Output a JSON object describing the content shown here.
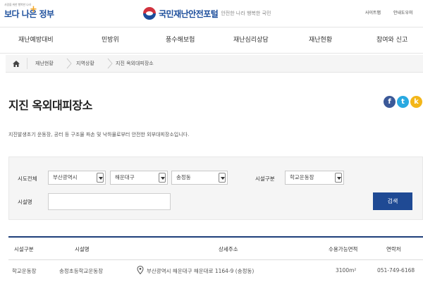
{
  "header": {
    "slogan_small": "사람을 위한 행복한 나라",
    "slogan_big": "보다 나은 정부",
    "title": "국민재난안전포털",
    "subtitle": "안전한 나라 행복한 국민",
    "util_sitemap": "사이트맵",
    "util_help": "안내도우미"
  },
  "gnb": [
    "재난예방대비",
    "민방위",
    "풍수해보험",
    "재난심리상담",
    "재난현황",
    "참여와 신고"
  ],
  "breadcrumb": [
    "재난현황",
    "지역상황",
    "지진 옥외대피장소"
  ],
  "page": {
    "title": "지진 옥외대피장소",
    "description": "지진발생초기 운동장, 공터 등 구조물 파손 및 낙하물로부터 안전한 외부대피장소입니다."
  },
  "social": {
    "facebook": "f",
    "twitter": "t",
    "kakao": "k"
  },
  "search": {
    "region_label": "시도전체",
    "sido": "부산광역시",
    "sigungu": "해운대구",
    "dong": "송정동",
    "facility_type_label": "시설구분",
    "facility_type": "학교운동장",
    "facility_name_label": "시설명",
    "facility_name_value": "",
    "search_button": "검색"
  },
  "table": {
    "headers": [
      "시설구분",
      "시설명",
      "상세주소",
      "수용가능면적",
      "연락처"
    ],
    "rows": [
      [
        "학교운동장",
        "송정초등학교운동장",
        "부산광역시 해운대구 해운대로 1164-9 (송정동)",
        "3100m²",
        "051-749-6168"
      ]
    ]
  },
  "colors": {
    "brand_blue": "#1b4d9b",
    "brand_red": "#d1323e",
    "search_button": "#1f4a94",
    "table_top_border": "#1f3f7a",
    "facebook": "#3b5998",
    "twitter": "#29a9e1",
    "kakao": "#f3b619"
  }
}
